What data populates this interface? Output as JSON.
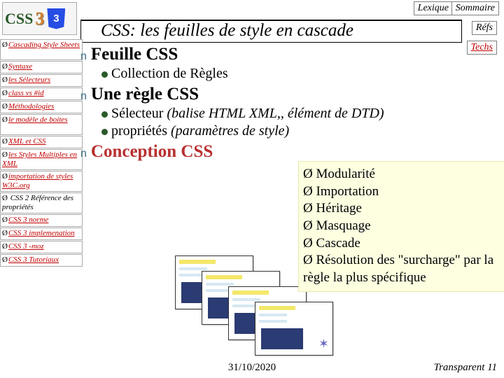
{
  "topnav": {
    "lexique": "Lexique",
    "sommaire": "Sommaire",
    "refs": "Réfs",
    "techs": "Techs"
  },
  "logo": {
    "css": "CSS",
    "year": "3",
    "shield": "3"
  },
  "title": "CSS: les feuilles de style en cascade",
  "sidebar": [
    {
      "label": "Cascading Style Sheets",
      "double": true
    },
    {
      "label": "Syntaxe"
    },
    {
      "label": "les Sélecteurs"
    },
    {
      "label": "class vs #id"
    },
    {
      "label": "Méthodologies"
    },
    {
      "label": "le modèle de boites",
      "double": true
    },
    {
      "label": "XML et CSS"
    },
    {
      "label": "les Styles Multiples en XML",
      "double": true
    },
    {
      "label": "importation de styles W3C.org",
      "double": true
    },
    {
      "label": " CSS 2 Référence des propriétés",
      "double": true,
      "plain": true
    },
    {
      "label": "CSS 3 norme"
    },
    {
      "label": "CSS 3 implemenation"
    },
    {
      "label": "CSS 3 -moz"
    },
    {
      "label": "CSS 3 Tutoriaux"
    }
  ],
  "content": {
    "h1_feuille": "Feuille CSS",
    "sub_collection": "Collection de Règles",
    "h1_regle": "Une règle CSS",
    "sub_selecteur_prefix": "Sélecteur",
    "sub_selecteur_suffix": " (balise HTML XML,, élément de DTD)",
    "sub_props_prefix": "propriétés ",
    "sub_props_suffix": "(paramètres de style)",
    "h1_conception": "Conception CSS"
  },
  "overlay": [
    "Modularité",
    "Importation",
    "Héritage",
    "Masquage",
    "Cascade",
    "Résolution des \"surcharge\" par la règle la plus spécifique"
  ],
  "footer": {
    "date": "31/10/2020",
    "slide": "Transparent 11"
  }
}
